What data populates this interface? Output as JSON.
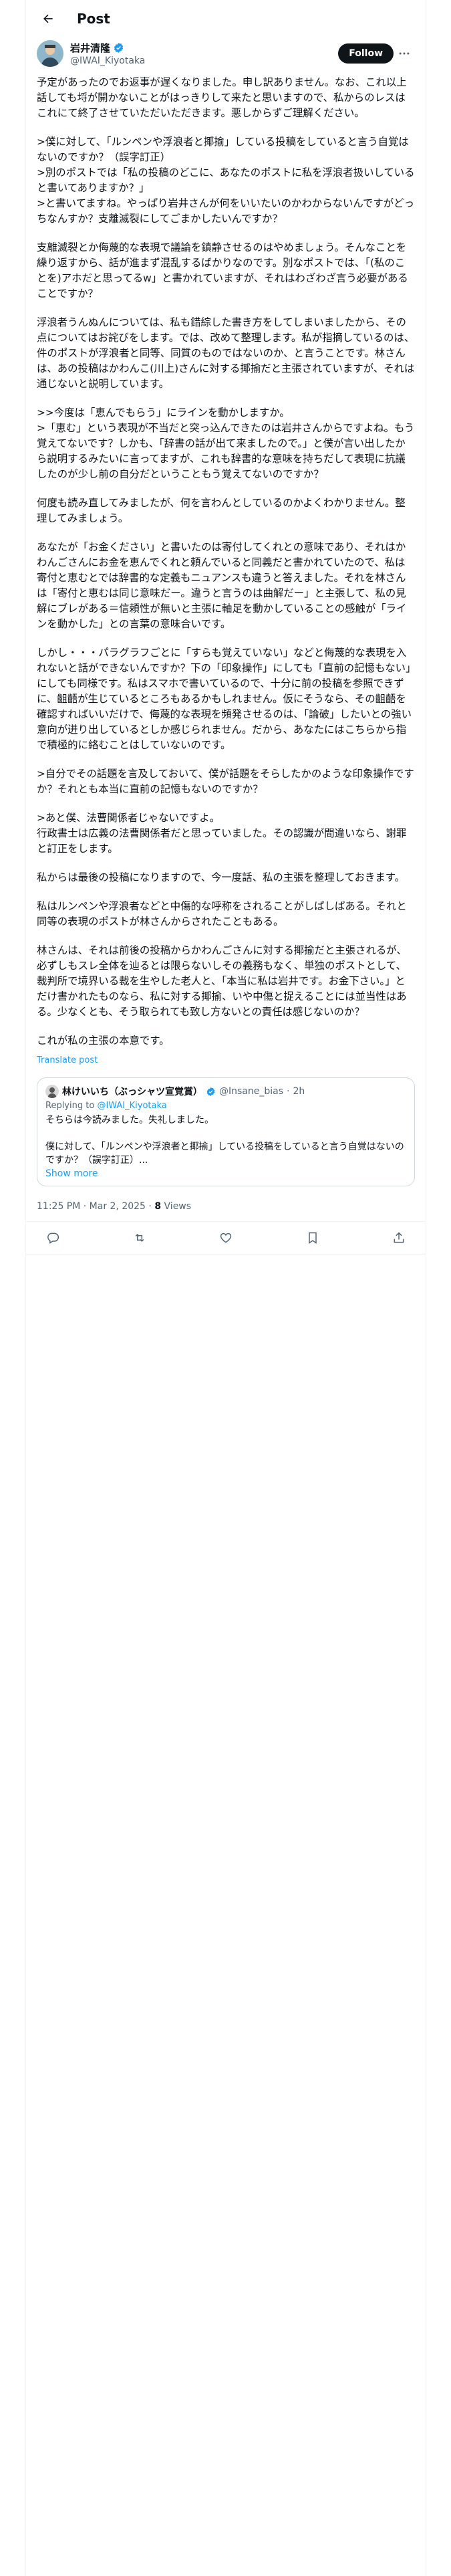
{
  "header": {
    "title": "Post"
  },
  "author": {
    "name": "岩井清隆",
    "handle": "@IWAI_Kiyotaka",
    "follow_label": "Follow"
  },
  "post": {
    "paragraphs": [
      "予定があったのでお返事が遅くなりました。申し訳ありません。なお、これ以上話しても埒が開かないことがはっきりして来たと思いますので、私からのレスはこれにて終了させていただいただきます。悪しからずご理解ください。",
      ">僕に対して、「ルンペンや浮浪者と揶揄」している投稿をしていると言う自覚はないのですか？（誤字訂正）\n>別のポストでは「私の投稿のどこに、あなたのポストに私を浮浪者扱いしていると書いてありますか？」\n>と書いてますね。やっぱり岩井さんが何をいいたいのかわからないんですがどっちなんすか？支離滅裂にしてごまかしたいんですか？",
      "支離滅裂とか侮蔑的な表現で議論を鎮静させるのはやめましょう。そんなことを繰り返すから、話が進まず混乱するばかりなのです。別なポストでは、「(私のことを)アホだと思ってるw」と書かれていますが、それはわざわざ言う必要があることですか？",
      "浮浪者うんぬんについては、私も錯綜した書き方をしてしまいましたから、その点についてはお詫びをします。では、改めて整理します。私が指摘しているのは、件のポストが浮浪者と同等、同質のものではないのか、と言うことです。林さんは、あの投稿はかわんこ(川上)さんに対する揶揄だと主張されていますが、それは通じないと説明しています。",
      ">>今度は「恵んでもらう」にラインを動かしますか。\n>「恵む」という表現が不当だと突っ込んできたのは岩井さんからですよね。もう覚えてないです？しかも、「辞書の話が出て来ましたので。」と僕が言い出したから説明するみたいに言ってますが、これも辞書的な意味を持ちだして表現に抗議したのが少し前の自分だということもう覚えてないのですか？",
      "何度も読み直してみましたが、何を言わんとしているのかよくわかりません。整理してみましょう。",
      "あなたが「お金ください」と書いたのは寄付してくれとの意味であり、それはかわんごさんにお金を恵んでくれと頼んでいると同義だと書かれていたので、私は寄付と恵むとでは辞書的な定義もニュアンスも違うと答えました。それを林さんは「寄付と恵むは同じ意味だー。違うと言うのは曲解だー」と主張して、私の見解にブレがある＝信頼性が無いと主張に軸足を動かしていることの感触が「ラインを動かした」との言葉の意味合いです。",
      "しかし・・・パラグラフごとに「すらも覚えていない」などと侮蔑的な表現を入れないと話ができないんですか？下の「印象操作」にしても「直前の記憶もない」にしても同様です。私はスマホで書いているので、十分に前の投稿を参照できずに、齟齬が生じているところもあるかもしれません。仮にそうなら、その齟齬を確認すればいいだけで、侮蔑的な表現を頻発させるのは、「論破」したいとの強い意向が迸り出しているとしか感じられません。だから、あなたにはこちらから指で積極的に絡むことはしていないのです。",
      ">自分でその話題を言及しておいて、僕が話題をそらしたかのような印象操作ですか？それとも本当に直前の記憶もないのですか？",
      ">あと僕、法曹関係者じゃないですよ。\n行政書士は広義の法曹関係者だと思っていました。その認識が間違いなら、謝罪と訂正をします。",
      "私からは最後の投稿になりますので、今一度話、私の主張を整理しておきます。",
      "私はルンペンや浮浪者などと中傷的な呼称をされることがしばしばある。それと同等の表現のポストが林さんからされたこともある。",
      "林さんは、それは前後の投稿からかわんごさんに対する揶揄だと主張されるが、必ずしもスレ全体を辿るとは限らないしその義務もなく、単独のポストとして、裁判所で境界いる裁を生やした老人と、「本当に私は岩井です。お金下さい。」とだけ書かれたものなら、私に対する揶揄、いや中傷と捉えることには並当性はある。少なくとも、そう取られても致し方ないとの責任は感じないのか？",
      "これが私の主張の本意です。"
    ],
    "translate_label": "Translate post",
    "timestamp": "11:25 PM · Mar 2, 2025",
    "views_count": "8",
    "views_label": "Views"
  },
  "quote": {
    "name": "林けいいち（ぶっシャツ宣覚賞）",
    "handle": "@Insane_bias",
    "dot": "·",
    "time": "2h",
    "replying_prefix": "Replying to ",
    "replying_handle": "@IWAI_Kiyotaka",
    "text": "そちらは今読みました。失礼しました。\n\n僕に対して、「ルンペンや浮浪者と揶揄」している投稿をしていると言う自覚はないのですか？（誤字訂正）...",
    "show_more": "Show more"
  },
  "icons": [
    "back-arrow-icon",
    "verified-badge-icon",
    "more-icon",
    "reply-icon",
    "repost-icon",
    "like-icon",
    "bookmark-icon",
    "share-icon"
  ],
  "colors": {
    "accent": "#1d9bf0",
    "text": "#0f1419",
    "muted": "#536471",
    "border": "#cfd9de"
  }
}
